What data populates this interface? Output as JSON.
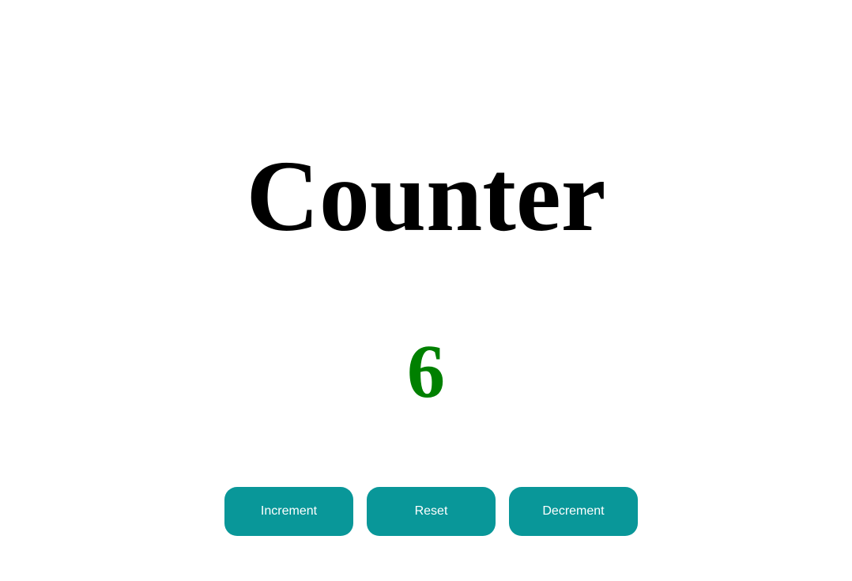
{
  "title": "Counter",
  "count": "6",
  "colors": {
    "count": "#008000",
    "button_bg": "#099799",
    "button_text": "#ffffff"
  },
  "buttons": {
    "increment": "Increment",
    "reset": "Reset",
    "decrement": "Decrement"
  }
}
